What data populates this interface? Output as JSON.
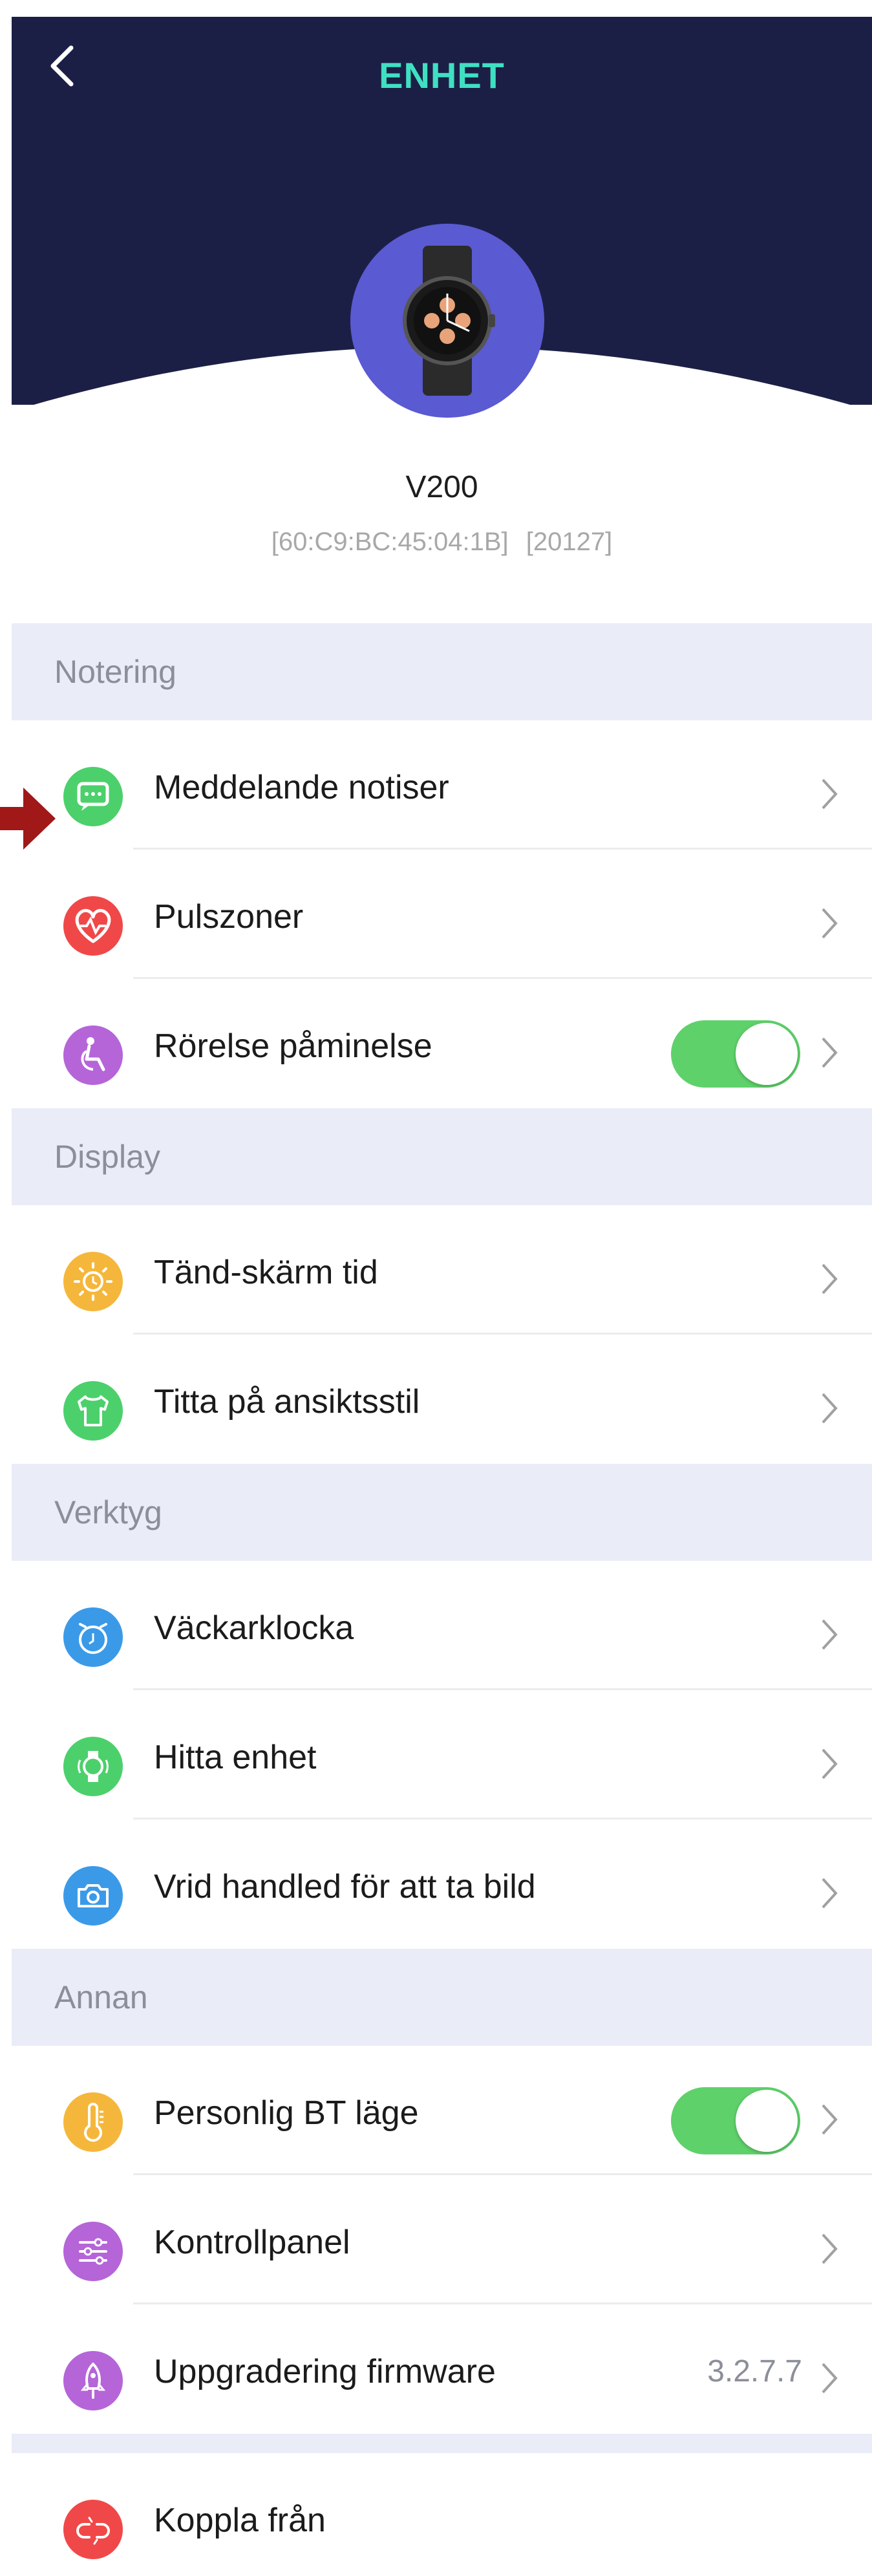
{
  "header": {
    "title": "ENHET",
    "background_color": "#1c1f45",
    "title_color": "#3fe0c2"
  },
  "device": {
    "name": "V200",
    "mac": "[60:C9:BC:45:04:1B]",
    "id": "[20127]",
    "avatar_color": "#5a5ad2"
  },
  "sections": {
    "notering": {
      "label": "Notering",
      "items": [
        {
          "label": "Meddelande notiser",
          "icon": "message-icon",
          "icon_color": "#4cd06b"
        },
        {
          "label": "Pulszoner",
          "icon": "heart-pulse-icon",
          "icon_color": "#f04848"
        },
        {
          "label": "Rörelse påminelse",
          "icon": "sitting-person-icon",
          "icon_color": "#b565d8",
          "toggle": true
        }
      ]
    },
    "display": {
      "label": "Display",
      "items": [
        {
          "label": "Tänd-skärm tid",
          "icon": "sun-clock-icon",
          "icon_color": "#f5b73b"
        },
        {
          "label": "Titta på ansiktsstil",
          "icon": "shirt-icon",
          "icon_color": "#4cd06b"
        }
      ]
    },
    "verktyg": {
      "label": "Verktyg",
      "items": [
        {
          "label": "Väckarklocka",
          "icon": "alarm-clock-icon",
          "icon_color": "#3b9ae8"
        },
        {
          "label": "Hitta enhet",
          "icon": "find-watch-icon",
          "icon_color": "#4cd06b"
        },
        {
          "label": "Vrid handled för att ta bild",
          "icon": "camera-icon",
          "icon_color": "#3b9ae8"
        }
      ]
    },
    "annan": {
      "label": "Annan",
      "items": [
        {
          "label": "Personlig BT läge",
          "icon": "thermometer-icon",
          "icon_color": "#f5b73b",
          "toggle": true
        },
        {
          "label": "Kontrollpanel",
          "icon": "sliders-icon",
          "icon_color": "#b565d8"
        },
        {
          "label": "Uppgradering firmware",
          "icon": "rocket-icon",
          "icon_color": "#b565d8",
          "value": "3.2.7.7"
        }
      ]
    }
  },
  "disconnect": {
    "label": "Koppla från",
    "icon": "unlink-icon",
    "icon_color": "#f04848"
  },
  "toggle_on_color": "#5fd16b",
  "annotation_arrow_color": "#a01818"
}
